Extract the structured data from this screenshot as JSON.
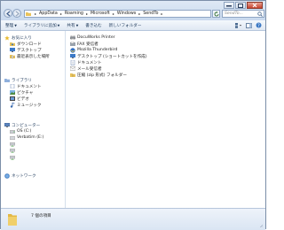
{
  "address": {
    "breadcrumbs": [
      "AppData",
      "Roaming",
      "Microsoft",
      "Windows",
      "SendTo"
    ]
  },
  "search": {
    "placeholder": "SendTo..."
  },
  "toolbar": {
    "organize_label": "整理",
    "library_label": "ライブラリに追加",
    "share_label": "共有",
    "burn_label": "書き込む",
    "new_folder_label": "新しいフォルダー"
  },
  "sidebar": {
    "favorites": {
      "label": "お気に入り",
      "items": [
        "ダウンロード",
        "デスクトップ",
        "最近表示した場所"
      ]
    },
    "libraries": {
      "label": "ライブラリ",
      "items": [
        "ドキュメント",
        "ピクチャ",
        "ビデオ",
        "ミュージック"
      ]
    },
    "computer": {
      "label": "コンピューター",
      "items": [
        "OS (C:)",
        "Verbatim (E:)",
        "",
        "",
        ""
      ]
    },
    "network": {
      "label": "ネットワーク"
    }
  },
  "files": [
    {
      "name": "DocuWorks Printer",
      "icon": "printer-icon"
    },
    {
      "name": "FAX 受信者",
      "icon": "fax-icon"
    },
    {
      "name": "Mozilla Thunderbird",
      "icon": "thunderbird-icon"
    },
    {
      "name": "デスクトップ (ショートカットを作成)",
      "icon": "desktop-icon"
    },
    {
      "name": "ドキュメント",
      "icon": "document-icon"
    },
    {
      "name": "メール受信者",
      "icon": "mail-icon"
    },
    {
      "name": "圧縮 (zip 形式) フォルダー",
      "icon": "zip-folder-icon"
    }
  ],
  "details": {
    "text": "7 個の項目"
  },
  "colors": {
    "accent": "#1e395b",
    "folder": "#e8c25a",
    "toolbar_bg": "#dfe8f3"
  }
}
